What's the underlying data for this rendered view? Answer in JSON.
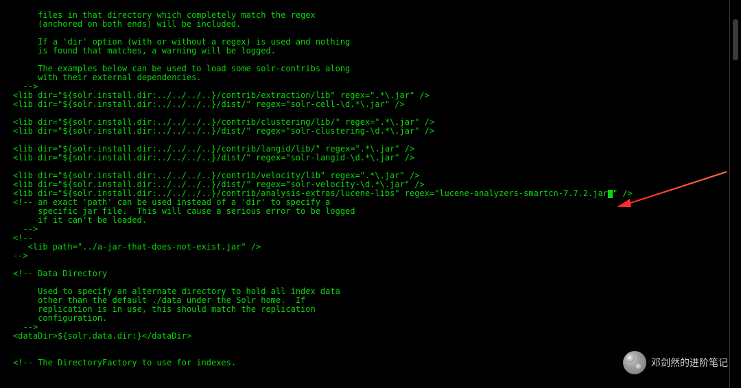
{
  "terminal": {
    "lines": {
      "l1": "     files in that directory which completely match the regex",
      "l2": "     (anchored on both ends) will be included.",
      "l3": "",
      "l4": "     If a 'dir' option (with or without a regex) is used and nothing",
      "l5": "     is found that matches, a warning will be logged.",
      "l6": "",
      "l7": "     The examples below can be used to load some solr-contribs along",
      "l8": "     with their external dependencies.",
      "l9": "  -->",
      "l10": "<lib dir=\"${solr.install.dir:../../../..}/contrib/extraction/lib\" regex=\".*\\.jar\" />",
      "l11": "<lib dir=\"${solr.install.dir:../../../..}/dist/\" regex=\"solr-cell-\\d.*\\.jar\" />",
      "l12": "",
      "l13": "<lib dir=\"${solr.install.dir:../../../..}/contrib/clustering/lib/\" regex=\".*\\.jar\" />",
      "l14": "<lib dir=\"${solr.install.dir:../../../..}/dist/\" regex=\"solr-clustering-\\d.*\\.jar\" />",
      "l15": "",
      "l16": "<lib dir=\"${solr.install.dir:../../../..}/contrib/langid/lib/\" regex=\".*\\.jar\" />",
      "l17": "<lib dir=\"${solr.install.dir:../../../..}/dist/\" regex=\"solr-langid-\\d.*\\.jar\" />",
      "l18": "",
      "l19": "<lib dir=\"${solr.install.dir:../../../..}/contrib/velocity/lib\" regex=\".*\\.jar\" />",
      "l20": "<lib dir=\"${solr.install.dir:../../../..}/dist/\" regex=\"solr-velocity-\\d.*\\.jar\" />",
      "l21a": "<lib dir=\"${solr.install.dir:../../../..}/contrib/analysis-extras/lucene-libs\" regex=\"lucene-analyzers-smartcn-7.7.2.jar",
      "l21b": "\" />",
      "l22": "<!-- an exact 'path' can be used instead of a 'dir' to specify a",
      "l23": "     specific jar file.  This will cause a serious error to be logged",
      "l24": "     if it can't be loaded.",
      "l25": "  -->",
      "l26": "<!--",
      "l27": "   <lib path=\"../a-jar-that-does-not-exist.jar\" />",
      "l28": "-->",
      "l29": "",
      "l30": "<!-- Data Directory",
      "l31": "",
      "l32": "     Used to specify an alternate directory to hold all index data",
      "l33": "     other than the default ./data under the Solr home.  If",
      "l34": "     replication is in use, this should match the replication",
      "l35": "     configuration.",
      "l36": "  -->",
      "l37": "<dataDir>${solr.data.dir:}</dataDir>",
      "l38": "",
      "l39": "",
      "l40": "<!-- The DirectoryFactory to use for indexes."
    }
  },
  "watermark": {
    "text": "邓剑然的进阶笔记"
  },
  "annotations": {
    "arrow_name": "highlight-arrow"
  }
}
